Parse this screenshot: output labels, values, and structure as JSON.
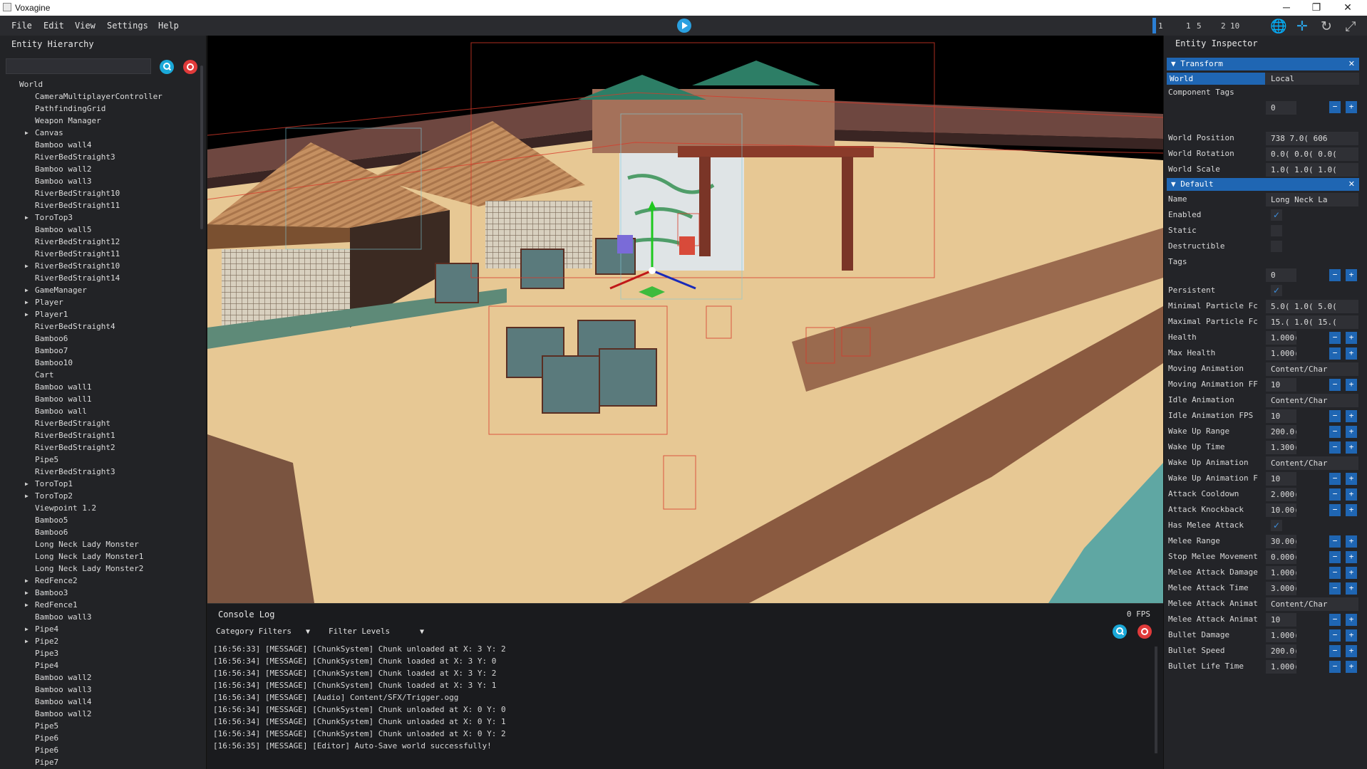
{
  "window": {
    "title": "Voxagine",
    "minimize": "─",
    "restore": "❐",
    "close": "✕"
  },
  "menu": [
    "File",
    "Edit",
    "View",
    "Settings",
    "Help"
  ],
  "toolbar": {
    "nums": [
      "1",
      "1",
      "5",
      "2",
      "10"
    ]
  },
  "hierarchy": {
    "title": "Entity Hierarchy",
    "search_value": "",
    "items": [
      {
        "label": "World",
        "depth": 0,
        "expandable": false
      },
      {
        "label": "CameraMultiplayerController",
        "depth": 1,
        "expandable": false
      },
      {
        "label": "PathfindingGrid",
        "depth": 1,
        "expandable": false
      },
      {
        "label": "Weapon Manager",
        "depth": 1,
        "expandable": false
      },
      {
        "label": "Canvas",
        "depth": 1,
        "expandable": true
      },
      {
        "label": "Bamboo wall4",
        "depth": 1,
        "expandable": false
      },
      {
        "label": "RiverBedStraight3",
        "depth": 1,
        "expandable": false
      },
      {
        "label": "Bamboo wall2",
        "depth": 1,
        "expandable": false
      },
      {
        "label": "Bamboo wall3",
        "depth": 1,
        "expandable": false
      },
      {
        "label": "RiverBedStraight10",
        "depth": 1,
        "expandable": false
      },
      {
        "label": "RiverBedStraight11",
        "depth": 1,
        "expandable": false
      },
      {
        "label": "ToroTop3",
        "depth": 1,
        "expandable": true
      },
      {
        "label": "Bamboo wall5",
        "depth": 1,
        "expandable": false
      },
      {
        "label": "RiverBedStraight12",
        "depth": 1,
        "expandable": false
      },
      {
        "label": "RiverBedStraight11",
        "depth": 1,
        "expandable": false
      },
      {
        "label": "RiverBedStraight10",
        "depth": 1,
        "expandable": true
      },
      {
        "label": "RiverBedStraight14",
        "depth": 1,
        "expandable": false
      },
      {
        "label": "GameManager",
        "depth": 1,
        "expandable": true
      },
      {
        "label": "Player",
        "depth": 1,
        "expandable": true
      },
      {
        "label": "Player1",
        "depth": 1,
        "expandable": true
      },
      {
        "label": "RiverBedStraight4",
        "depth": 1,
        "expandable": false
      },
      {
        "label": "Bamboo6",
        "depth": 1,
        "expandable": false
      },
      {
        "label": "Bamboo7",
        "depth": 1,
        "expandable": false
      },
      {
        "label": "Bamboo10",
        "depth": 1,
        "expandable": false
      },
      {
        "label": "Cart",
        "depth": 1,
        "expandable": false
      },
      {
        "label": "Bamboo wall1",
        "depth": 1,
        "expandable": false
      },
      {
        "label": "Bamboo wall1",
        "depth": 1,
        "expandable": false
      },
      {
        "label": "Bamboo wall",
        "depth": 1,
        "expandable": false
      },
      {
        "label": "RiverBedStraight",
        "depth": 1,
        "expandable": false
      },
      {
        "label": "RiverBedStraight1",
        "depth": 1,
        "expandable": false
      },
      {
        "label": "RiverBedStraight2",
        "depth": 1,
        "expandable": false
      },
      {
        "label": "Pipe5",
        "depth": 1,
        "expandable": false
      },
      {
        "label": "RiverBedStraight3",
        "depth": 1,
        "expandable": false
      },
      {
        "label": "ToroTop1",
        "depth": 1,
        "expandable": true
      },
      {
        "label": "ToroTop2",
        "depth": 1,
        "expandable": true
      },
      {
        "label": "Viewpoint 1.2",
        "depth": 1,
        "expandable": false
      },
      {
        "label": "Bamboo5",
        "depth": 1,
        "expandable": false
      },
      {
        "label": "Bamboo6",
        "depth": 1,
        "expandable": false
      },
      {
        "label": "Long Neck Lady Monster",
        "depth": 1,
        "expandable": false
      },
      {
        "label": "Long Neck Lady Monster1",
        "depth": 1,
        "expandable": false
      },
      {
        "label": "Long Neck Lady Monster2",
        "depth": 1,
        "expandable": false
      },
      {
        "label": "RedFence2",
        "depth": 1,
        "expandable": true
      },
      {
        "label": "Bamboo3",
        "depth": 1,
        "expandable": true
      },
      {
        "label": "RedFence1",
        "depth": 1,
        "expandable": true
      },
      {
        "label": "Bamboo wall3",
        "depth": 1,
        "expandable": false
      },
      {
        "label": "Pipe4",
        "depth": 1,
        "expandable": true
      },
      {
        "label": "Pipe2",
        "depth": 1,
        "expandable": true
      },
      {
        "label": "Pipe3",
        "depth": 1,
        "expandable": false
      },
      {
        "label": "Pipe4",
        "depth": 1,
        "expandable": false
      },
      {
        "label": "Bamboo wall2",
        "depth": 1,
        "expandable": false
      },
      {
        "label": "Bamboo wall3",
        "depth": 1,
        "expandable": false
      },
      {
        "label": "Bamboo wall4",
        "depth": 1,
        "expandable": false
      },
      {
        "label": "Bamboo wall2",
        "depth": 1,
        "expandable": false
      },
      {
        "label": "Pipe5",
        "depth": 1,
        "expandable": false
      },
      {
        "label": "Pipe6",
        "depth": 1,
        "expandable": false
      },
      {
        "label": "Pipe6",
        "depth": 1,
        "expandable": false
      },
      {
        "label": "Pipe7",
        "depth": 1,
        "expandable": false
      }
    ]
  },
  "console": {
    "title": "Console Log",
    "fps": "0 FPS",
    "category_filters": "Category Filters",
    "filter_levels": "Filter Levels",
    "lines": [
      "[16:56:33] [MESSAGE] [ChunkSystem] Chunk unloaded at X: 3 Y: 2",
      "[16:56:34] [MESSAGE] [ChunkSystem] Chunk loaded at X: 3 Y: 0",
      "[16:56:34] [MESSAGE] [ChunkSystem] Chunk loaded at X: 3 Y: 2",
      "[16:56:34] [MESSAGE] [ChunkSystem] Chunk loaded at X: 3 Y: 1",
      "[16:56:34] [MESSAGE] [Audio] Content/SFX/Trigger.ogg",
      "[16:56:34] [MESSAGE] [ChunkSystem] Chunk unloaded at X: 0 Y: 0",
      "[16:56:34] [MESSAGE] [ChunkSystem] Chunk unloaded at X: 0 Y: 1",
      "[16:56:34] [MESSAGE] [ChunkSystem] Chunk unloaded at X: 0 Y: 2",
      "[16:56:35] [MESSAGE] [Editor] Auto-Save world successfully!"
    ]
  },
  "inspector": {
    "title": "Entity Inspector",
    "transform": {
      "header": "Transform",
      "world": "World",
      "local": "Local",
      "component_tags_label": "Component Tags",
      "component_tags_value": "0",
      "rows": [
        {
          "label": "World Position",
          "value": "738 7.0( 606"
        },
        {
          "label": "World Rotation",
          "value": "0.0( 0.0( 0.0("
        },
        {
          "label": "World Scale",
          "value": "1.0( 1.0( 1.0("
        }
      ]
    },
    "default": {
      "header": "Default",
      "rows": [
        {
          "label": "Name",
          "type": "text",
          "value": "Long Neck La"
        },
        {
          "label": "Enabled",
          "type": "check",
          "checked": true
        },
        {
          "label": "Static",
          "type": "check",
          "checked": false
        },
        {
          "label": "Destructible",
          "type": "check",
          "checked": false
        },
        {
          "label": "Tags",
          "type": "stepper",
          "value": "0",
          "below": true
        },
        {
          "label": "Persistent",
          "type": "check",
          "checked": true
        },
        {
          "label": "Minimal Particle Fc",
          "type": "text",
          "value": "5.0( 1.0( 5.0("
        },
        {
          "label": "Maximal Particle Fc",
          "type": "text",
          "value": "15.( 1.0( 15.("
        },
        {
          "label": "Health",
          "type": "stepper",
          "value": "1.000("
        },
        {
          "label": "Max Health",
          "type": "stepper",
          "value": "1.000("
        },
        {
          "label": "Moving Animation",
          "type": "text",
          "value": "Content/Char"
        },
        {
          "label": "Moving Animation FF",
          "type": "stepper",
          "value": "10"
        },
        {
          "label": "Idle Animation",
          "type": "text",
          "value": "Content/Char"
        },
        {
          "label": "Idle Animation FPS",
          "type": "stepper",
          "value": "10"
        },
        {
          "label": "Wake Up Range",
          "type": "stepper",
          "value": "200.0("
        },
        {
          "label": "Wake Up Time",
          "type": "stepper",
          "value": "1.300("
        },
        {
          "label": "Wake Up Animation",
          "type": "text",
          "value": "Content/Char"
        },
        {
          "label": "Wake Up Animation F",
          "type": "stepper",
          "value": "10"
        },
        {
          "label": "Attack Cooldown",
          "type": "stepper",
          "value": "2.000("
        },
        {
          "label": "Attack Knockback",
          "type": "stepper",
          "value": "10.00("
        },
        {
          "label": "Has Melee Attack",
          "type": "check",
          "checked": true
        },
        {
          "label": "Melee Range",
          "type": "stepper",
          "value": "30.00("
        },
        {
          "label": "Stop Melee Movement",
          "type": "stepper",
          "value": "0.000("
        },
        {
          "label": "Melee Attack Damage",
          "type": "stepper",
          "value": "1.000("
        },
        {
          "label": "Melee Attack Time",
          "type": "stepper",
          "value": "3.000("
        },
        {
          "label": "Melee Attack Animat",
          "type": "text",
          "value": "Content/Char"
        },
        {
          "label": "Melee Attack Animat",
          "type": "stepper",
          "value": "10"
        },
        {
          "label": "Bullet Damage",
          "type": "stepper",
          "value": "1.000("
        },
        {
          "label": "Bullet Speed",
          "type": "stepper",
          "value": "200.0("
        },
        {
          "label": "Bullet Life Time",
          "type": "stepper",
          "value": "1.000("
        }
      ]
    }
  }
}
